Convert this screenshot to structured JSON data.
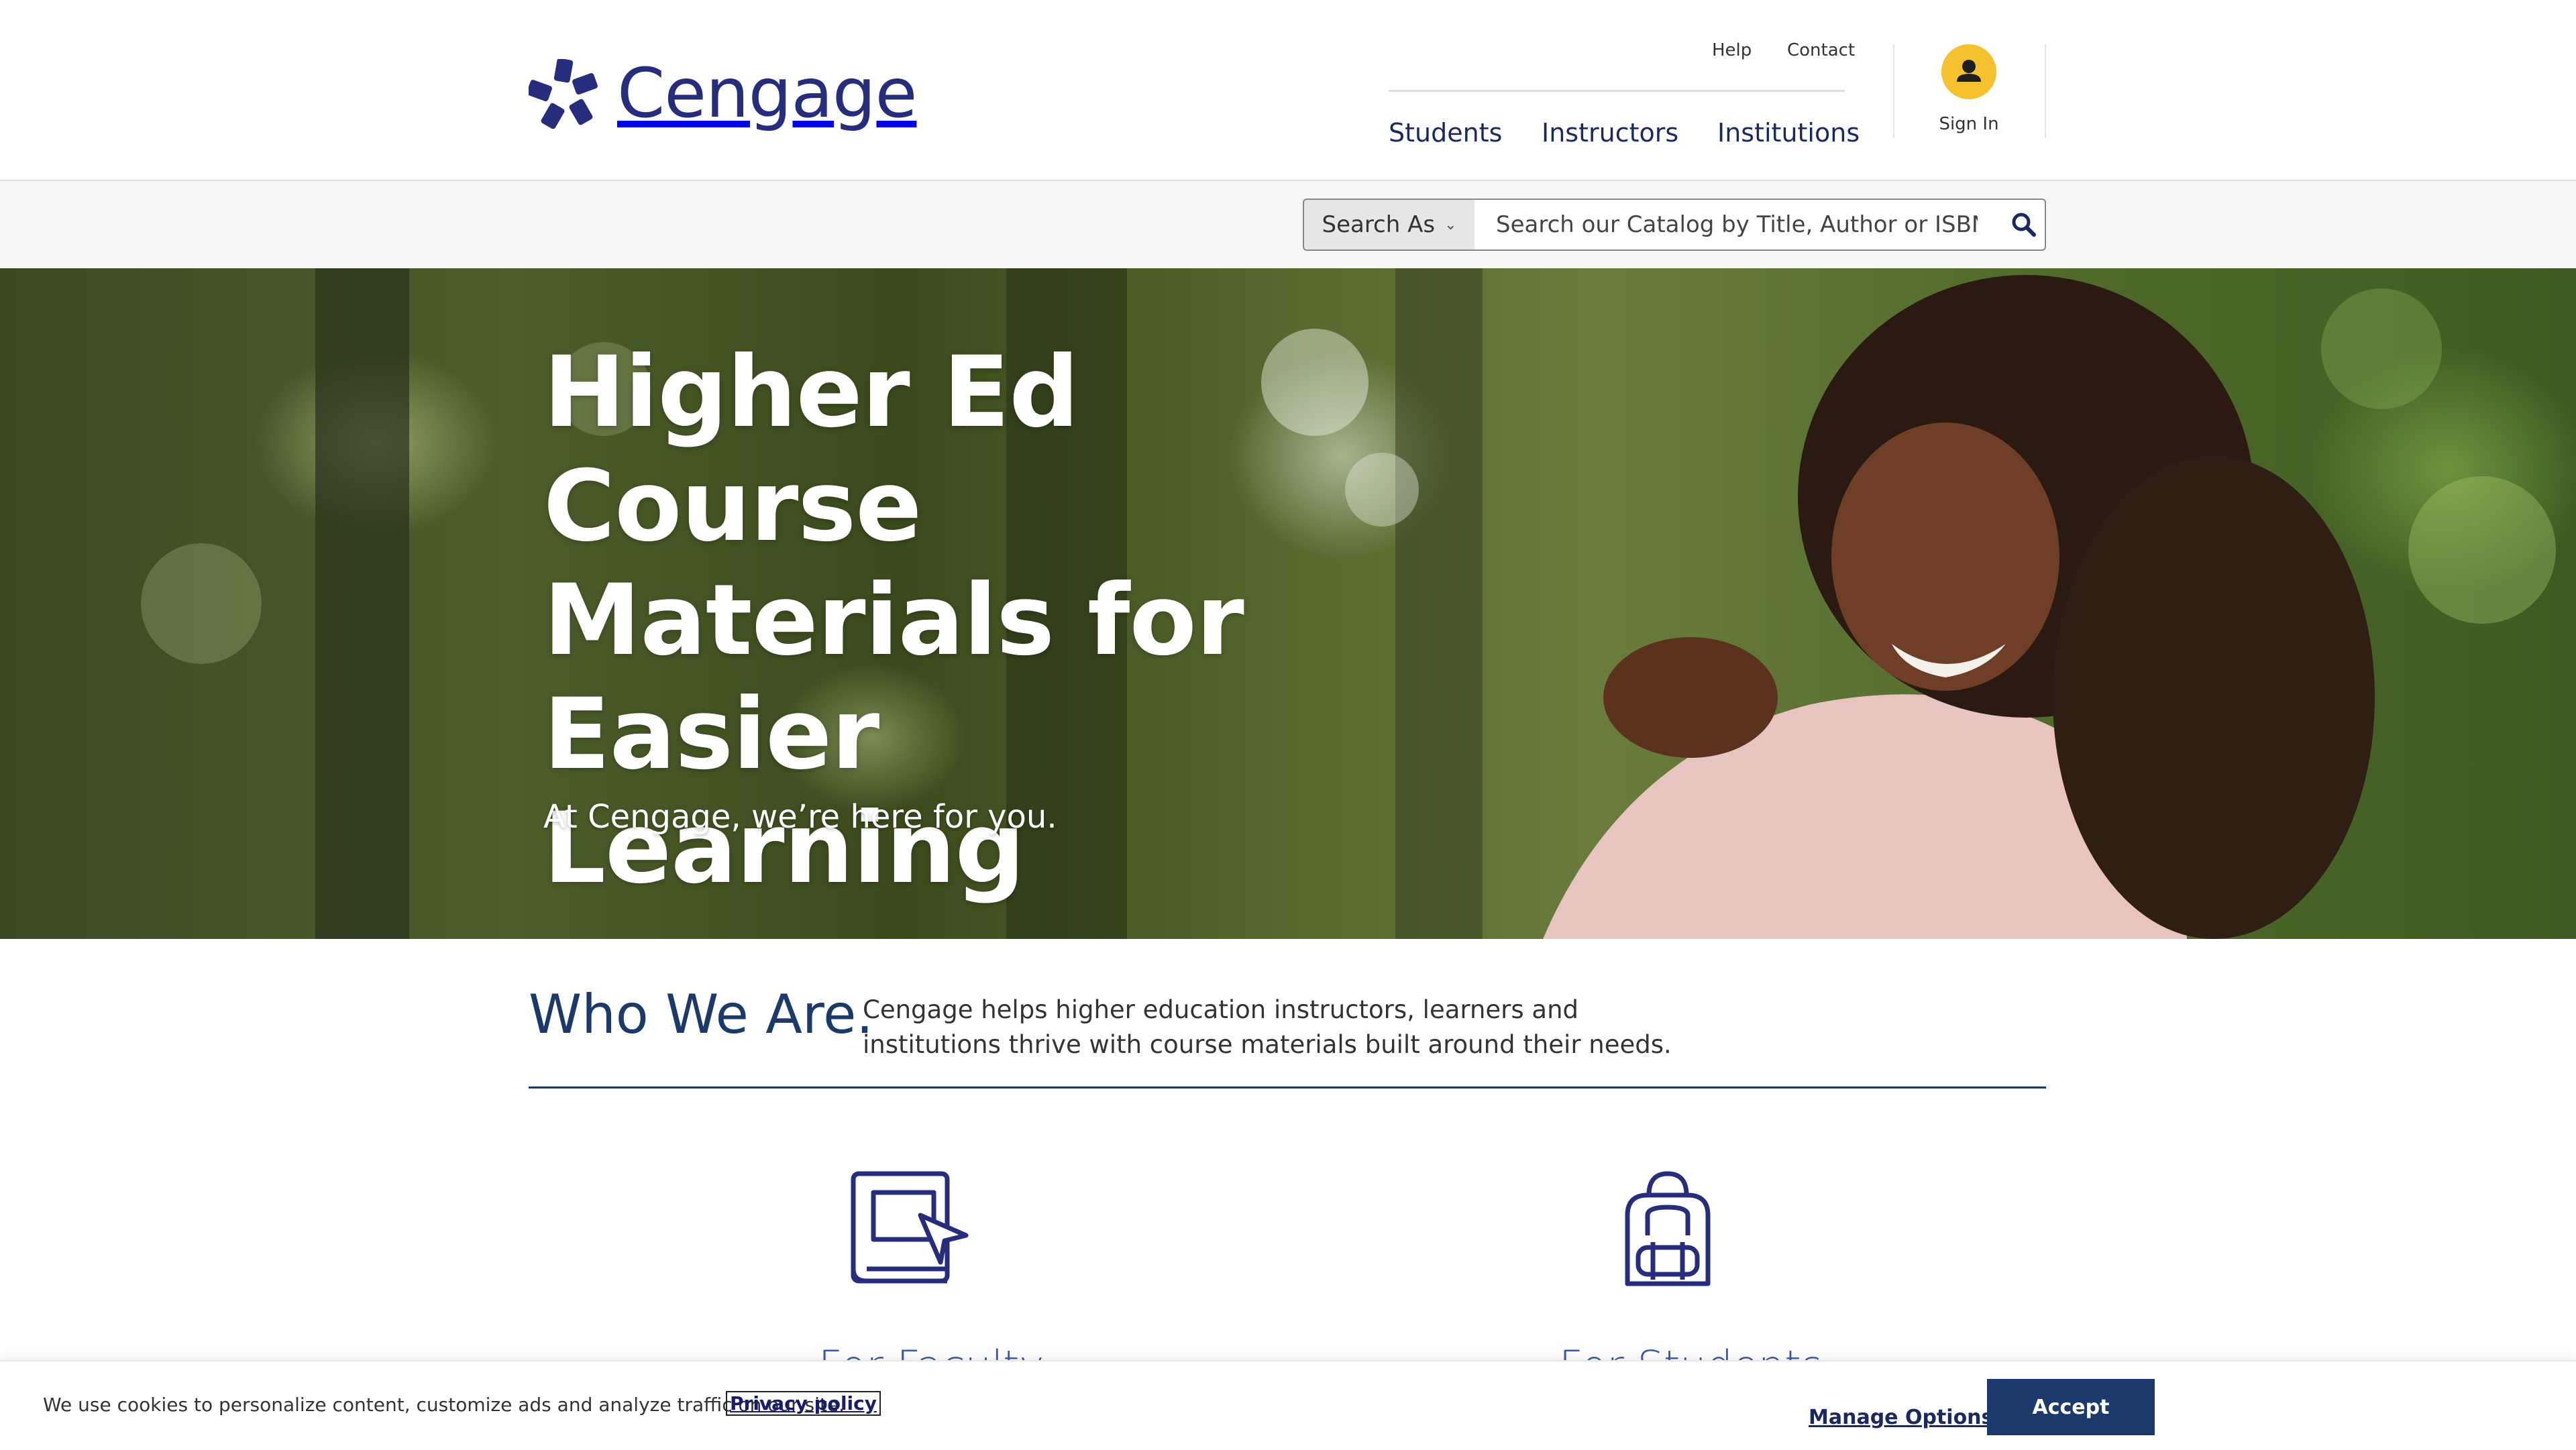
{
  "header": {
    "brand": "Cengage",
    "utility_links": [
      "Help",
      "Contact"
    ],
    "nav": [
      "Students",
      "Instructors",
      "Institutions"
    ],
    "sign_in": "Sign In",
    "accent_color": "#f5c12e",
    "brand_color": "#262d7d"
  },
  "search": {
    "search_as_label": "Search As",
    "placeholder": "Search our Catalog by Title, Author or ISBN",
    "button_icon": "search-icon"
  },
  "hero": {
    "title": "Higher Ed Course Materials for Easier Learning",
    "subtitle": "At Cengage, we’re here for you."
  },
  "who_we_are": {
    "title": "Who We Are.",
    "text": "Cengage helps higher education instructors, learners and institutions thrive with course materials built around their needs."
  },
  "features": [
    {
      "title": "For Faculty",
      "icon": "book-pointer-icon"
    },
    {
      "title": "For Students",
      "icon": "backpack-icon"
    }
  ],
  "cookie": {
    "text": "We use cookies to personalize content, customize ads and analyze traffic on our site.",
    "privacy_link": "Privacy policy",
    "manage_label": "Manage Options",
    "accept_label": "Accept"
  }
}
